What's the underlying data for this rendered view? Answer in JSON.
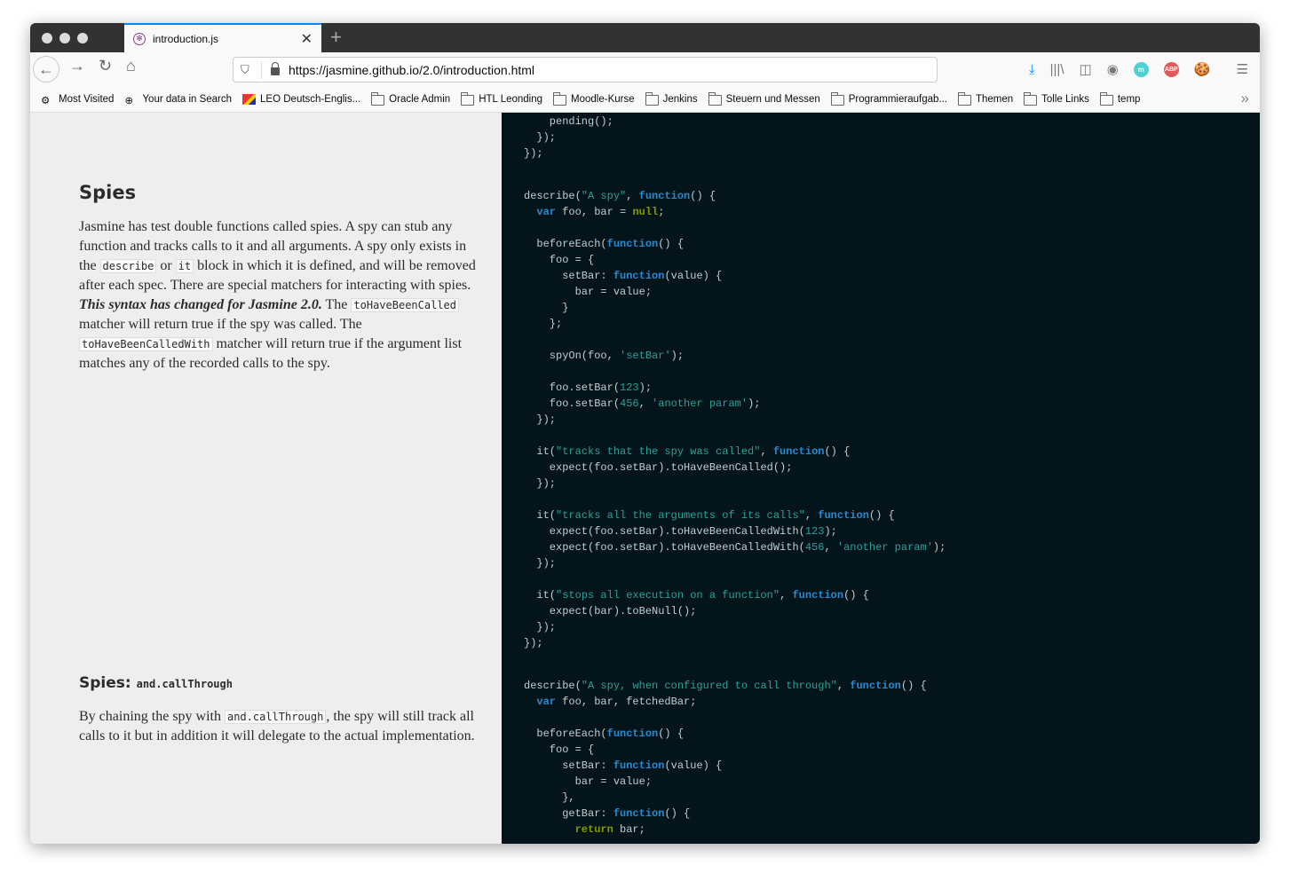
{
  "browser": {
    "tab_title": "introduction.js",
    "url": "https://jasmine.github.io/2.0/introduction.html",
    "bookmarks": [
      "Most Visited",
      "Your data in Search",
      "LEO Deutsch-Englis...",
      "Oracle Admin",
      "HTL Leonding",
      "Moodle-Kurse",
      "Jenkins",
      "Steuern und Messen",
      "Programmieraufgab...",
      "Themen",
      "Tolle Links",
      "temp"
    ],
    "ext_m": "m",
    "ext_abp": "ABP",
    "colors": {
      "tab_accent": "#0a84ff",
      "code_bg": "#04141b",
      "keyword": "#268bd2",
      "string": "#2aa198",
      "literal": "#859900"
    }
  },
  "doc": {
    "spies_title": "Spies",
    "spies_p": {
      "t1": "Jasmine has test double functions called spies. A spy can stub any function and tracks calls to it and all arguments. A spy only exists in the ",
      "c1": "describe",
      "t2": " or ",
      "c2": "it",
      "t3": " block in which it is defined, and will be removed after each spec. There are special matchers for interacting with spies. ",
      "em": "This syntax has changed for Jasmine 2.0.",
      "t4": " The ",
      "c3": "toHaveBeenCalled",
      "t5": " matcher will return true if the spy was called. The ",
      "c4": "toHaveBeenCalledWith",
      "t6": " matcher will return true if the argument list matches any of the recorded calls to the spy."
    },
    "callthrough_title": "Spies: ",
    "callthrough_code": "and.callThrough",
    "callthrough_p": {
      "t1": "By chaining the spy with ",
      "c1": "and.callThrough",
      "t2": ", the spy will still track all calls to it but in addition it will delegate to the actual implementation."
    }
  },
  "code": {
    "block1": [
      [
        [
          "p",
          "    pending();"
        ]
      ],
      [
        [
          "p",
          "  });"
        ]
      ],
      [
        [
          "p",
          "});"
        ]
      ]
    ],
    "block2": [
      [
        [
          "p",
          "describe("
        ],
        [
          "s",
          "\"A spy\""
        ],
        [
          "p",
          ", "
        ],
        [
          "k",
          "function"
        ],
        [
          "p",
          "() {"
        ]
      ],
      [
        [
          "p",
          "  "
        ],
        [
          "k",
          "var"
        ],
        [
          "p",
          " foo, bar = "
        ],
        [
          "l",
          "null"
        ],
        [
          "p",
          ";"
        ]
      ],
      [],
      [
        [
          "p",
          "  beforeEach("
        ],
        [
          "k",
          "function"
        ],
        [
          "p",
          "() {"
        ]
      ],
      [
        [
          "p",
          "    foo = {"
        ]
      ],
      [
        [
          "p",
          "      setBar: "
        ],
        [
          "k",
          "function"
        ],
        [
          "p",
          "(value) {"
        ]
      ],
      [
        [
          "p",
          "        bar = value;"
        ]
      ],
      [
        [
          "p",
          "      }"
        ]
      ],
      [
        [
          "p",
          "    };"
        ]
      ],
      [],
      [
        [
          "p",
          "    spyOn(foo, "
        ],
        [
          "s",
          "'setBar'"
        ],
        [
          "p",
          ");"
        ]
      ],
      [],
      [
        [
          "p",
          "    foo.setBar("
        ],
        [
          "n",
          "123"
        ],
        [
          "p",
          ");"
        ]
      ],
      [
        [
          "p",
          "    foo.setBar("
        ],
        [
          "n",
          "456"
        ],
        [
          "p",
          ", "
        ],
        [
          "s",
          "'another param'"
        ],
        [
          "p",
          ");"
        ]
      ],
      [
        [
          "p",
          "  });"
        ]
      ],
      [],
      [
        [
          "p",
          "  it("
        ],
        [
          "s",
          "\"tracks that the spy was called\""
        ],
        [
          "p",
          ", "
        ],
        [
          "k",
          "function"
        ],
        [
          "p",
          "() {"
        ]
      ],
      [
        [
          "p",
          "    expect(foo.setBar).toHaveBeenCalled();"
        ]
      ],
      [
        [
          "p",
          "  });"
        ]
      ],
      [],
      [
        [
          "p",
          "  it("
        ],
        [
          "s",
          "\"tracks all the arguments of its calls\""
        ],
        [
          "p",
          ", "
        ],
        [
          "k",
          "function"
        ],
        [
          "p",
          "() {"
        ]
      ],
      [
        [
          "p",
          "    expect(foo.setBar).toHaveBeenCalledWith("
        ],
        [
          "n",
          "123"
        ],
        [
          "p",
          ");"
        ]
      ],
      [
        [
          "p",
          "    expect(foo.setBar).toHaveBeenCalledWith("
        ],
        [
          "n",
          "456"
        ],
        [
          "p",
          ", "
        ],
        [
          "s",
          "'another param'"
        ],
        [
          "p",
          ");"
        ]
      ],
      [
        [
          "p",
          "  });"
        ]
      ],
      [],
      [
        [
          "p",
          "  it("
        ],
        [
          "s",
          "\"stops all execution on a function\""
        ],
        [
          "p",
          ", "
        ],
        [
          "k",
          "function"
        ],
        [
          "p",
          "() {"
        ]
      ],
      [
        [
          "p",
          "    expect(bar).toBeNull();"
        ]
      ],
      [
        [
          "p",
          "  });"
        ]
      ],
      [
        [
          "p",
          "});"
        ]
      ]
    ],
    "block3": [
      [
        [
          "p",
          "describe("
        ],
        [
          "s",
          "\"A spy, when configured to call through\""
        ],
        [
          "p",
          ", "
        ],
        [
          "k",
          "function"
        ],
        [
          "p",
          "() {"
        ]
      ],
      [
        [
          "p",
          "  "
        ],
        [
          "k",
          "var"
        ],
        [
          "p",
          " foo, bar, fetchedBar;"
        ]
      ],
      [],
      [
        [
          "p",
          "  beforeEach("
        ],
        [
          "k",
          "function"
        ],
        [
          "p",
          "() {"
        ]
      ],
      [
        [
          "p",
          "    foo = {"
        ]
      ],
      [
        [
          "p",
          "      setBar: "
        ],
        [
          "k",
          "function"
        ],
        [
          "p",
          "(value) {"
        ]
      ],
      [
        [
          "p",
          "        bar = value;"
        ]
      ],
      [
        [
          "p",
          "      },"
        ]
      ],
      [
        [
          "p",
          "      getBar: "
        ],
        [
          "k",
          "function"
        ],
        [
          "p",
          "() {"
        ]
      ],
      [
        [
          "p",
          "        "
        ],
        [
          "l",
          "return"
        ],
        [
          "p",
          " bar;"
        ]
      ]
    ]
  }
}
